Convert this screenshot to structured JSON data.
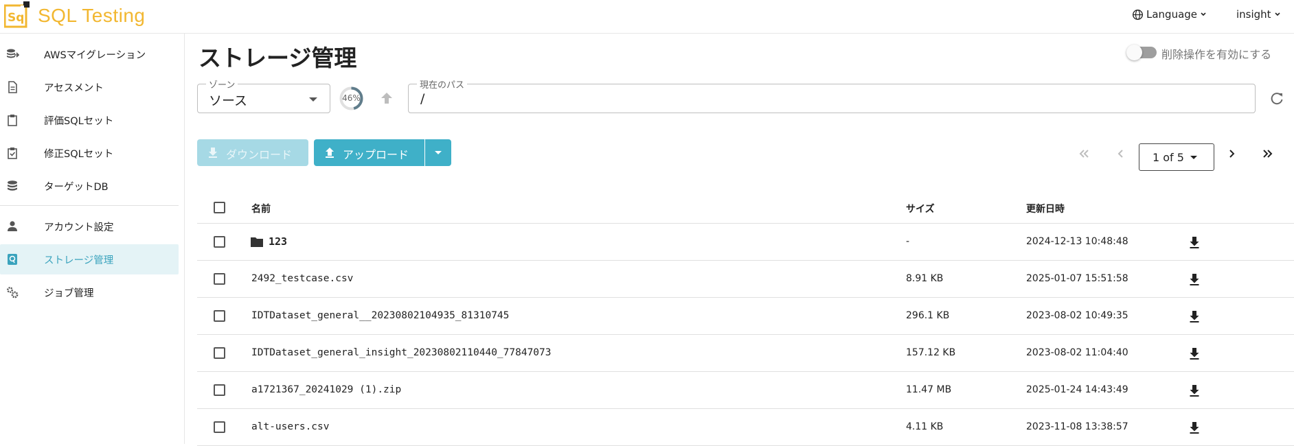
{
  "header": {
    "app_title": "SQL Testing",
    "logo_letters": "Sq",
    "language_label": "Language",
    "user_label": "insight"
  },
  "sidebar": {
    "items": [
      {
        "label": "AWSマイグレーション",
        "icon": "database-arrow-icon"
      },
      {
        "label": "アセスメント",
        "icon": "document-icon"
      },
      {
        "label": "評価SQLセット",
        "icon": "clipboard-icon"
      },
      {
        "label": "修正SQLセット",
        "icon": "clipboard-check-icon"
      },
      {
        "label": "ターゲットDB",
        "icon": "database-icon"
      },
      {
        "label": "アカウント設定",
        "icon": "person-icon"
      },
      {
        "label": "ストレージ管理",
        "icon": "storage-icon",
        "active": true
      },
      {
        "label": "ジョブ管理",
        "icon": "gears-icon"
      }
    ]
  },
  "main": {
    "title": "ストレージ管理",
    "delete_toggle_label": "削除操作を有効にする",
    "delete_toggle_on": false,
    "zone": {
      "legend": "ゾーン",
      "value": "ソース"
    },
    "usage_percent": 46,
    "usage_text": "46%",
    "path": {
      "legend": "現在のパス",
      "value": "/"
    },
    "download_label": "ダウンロード",
    "upload_label": "アップロード",
    "pager": {
      "page_text": "1 of 5"
    }
  },
  "table": {
    "headers": {
      "name": "名前",
      "size": "サイズ",
      "modified": "更新日時"
    },
    "rows": [
      {
        "name": "123",
        "type": "folder",
        "size": "-",
        "modified": "2024-12-13 10:48:48"
      },
      {
        "name": "2492_testcase.csv",
        "type": "file",
        "size": "8.91 KB",
        "modified": "2025-01-07 15:51:58"
      },
      {
        "name": "IDTDataset_general__20230802104935_81310745",
        "type": "file",
        "size": "296.1 KB",
        "modified": "2023-08-02 10:49:35"
      },
      {
        "name": "IDTDataset_general_insight_20230802110440_77847073",
        "type": "file",
        "size": "157.12 KB",
        "modified": "2023-08-02 11:04:40"
      },
      {
        "name": "a1721367_20241029 (1).zip",
        "type": "file",
        "size": "11.47 MB",
        "modified": "2025-01-24 14:43:49"
      },
      {
        "name": "alt-users.csv",
        "type": "file",
        "size": "4.11 KB",
        "modified": "2023-11-08 13:38:57"
      }
    ]
  },
  "colors": {
    "accent": "#3fb0c8",
    "accent_disabled": "#a6d9e5",
    "logo": "#f2b730",
    "active_bg": "#e4f3f6"
  }
}
